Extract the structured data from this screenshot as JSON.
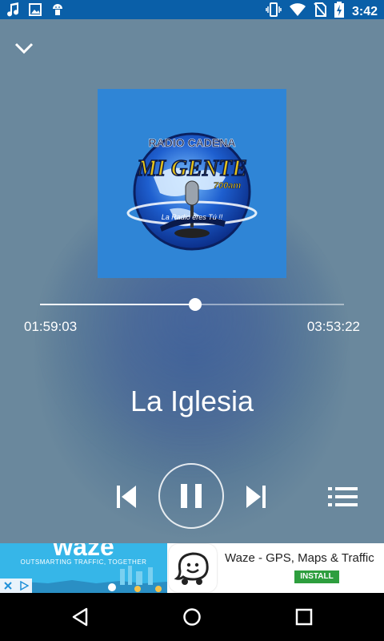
{
  "status_bar": {
    "time": "3:42",
    "left_icons": [
      "music-note-icon",
      "image-icon",
      "android-icon"
    ],
    "right_icons": [
      "vibrate-icon",
      "wifi-icon",
      "no-sim-icon",
      "battery-charging-icon"
    ]
  },
  "album_art": {
    "top_text": "RADIO CADENA",
    "brand": "MI GENTE",
    "frequency": "700am",
    "slogan": "La Radio eres Tú !!"
  },
  "player": {
    "elapsed": "01:59:03",
    "duration": "03:53:22",
    "progress": 0.51,
    "track_title": "La Iglesia"
  },
  "controls": {
    "prev_icon": "skip-previous-icon",
    "pause_icon": "pause-icon",
    "next_icon": "skip-next-icon",
    "playlist_icon": "playlist-icon"
  },
  "ad": {
    "brand": "waze",
    "tagline": "OUTSMARTING TRAFFIC, TOGETHER",
    "app_name": "Waze - GPS, Maps & Traffic",
    "install_label": "INSTALL"
  },
  "colors": {
    "status_bar": "#0a5fa8",
    "install_green": "#2e9e3e",
    "ad_blue": "#36b6e8"
  }
}
